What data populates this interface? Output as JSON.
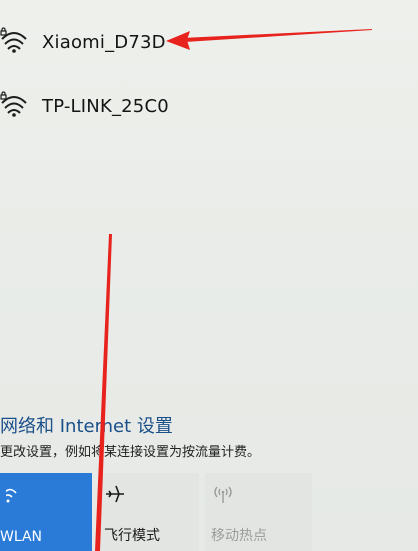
{
  "networks": [
    {
      "name": "Xiaomi_D73D",
      "icon": "wifi-secured-icon"
    },
    {
      "name": "TP-LINK_25C0",
      "icon": "wifi-secured-icon"
    }
  ],
  "settings": {
    "title": "网络和 Internet 设置",
    "subtitle": "更改设置，例如将某连接设置为按流量计费。"
  },
  "quick_actions": [
    {
      "label": "WLAN",
      "icon": "wifi-icon",
      "state": "on"
    },
    {
      "label": "飞行模式",
      "icon": "airplane-icon",
      "state": "off"
    },
    {
      "label": "移动热点",
      "icon": "hotspot-icon",
      "state": "disabled"
    }
  ],
  "colors": {
    "accent": "#2a7ad8",
    "settings_link": "#1a4f8a",
    "annotation_arrow": "#e8231e"
  }
}
